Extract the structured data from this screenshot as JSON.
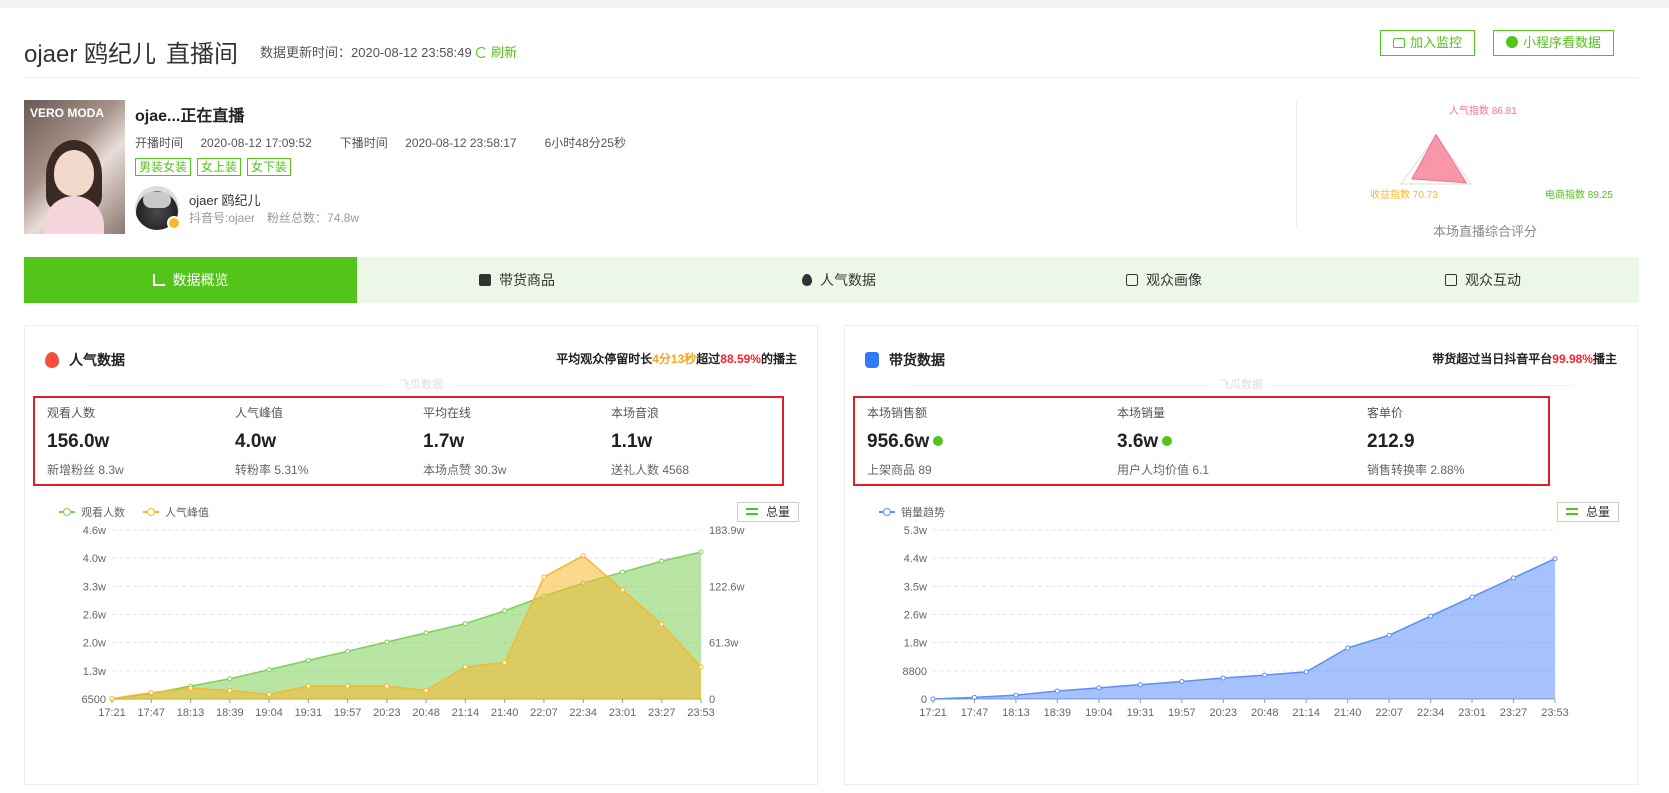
{
  "header": {
    "title_name": "ojaer 鸥纪儿",
    "title_suffix": "直播间",
    "update_label": "数据更新时间：",
    "update_time": "2020-08-12 23:58:49",
    "refresh_label": "刷新",
    "monitor_label": "加入监控",
    "miniapp_label": "小程序看数据"
  },
  "live": {
    "cover_logo": "VERO MODA",
    "title": "ojae...正在直播",
    "start_label": "开播时间",
    "start_time": "2020-08-12 17:09:52",
    "end_label": "下播时间",
    "end_time": "2020-08-12 23:58:17",
    "duration": "6小时48分25秒",
    "tags": [
      "男装女装",
      "女上装",
      "女下装"
    ],
    "author_name": "ojaer 鸥纪儿",
    "douyin_id": "抖音号:ojaer",
    "fans": "粉丝总数：74.8w"
  },
  "score": {
    "popularity": "人气指数 86.81",
    "revenue": "收益指数 70.73",
    "ecommerce": "电商指数 89.25",
    "title": "本场直播综合评分",
    "values": {
      "popularity": 86.81,
      "revenue": 70.73,
      "ecommerce": 89.25
    },
    "colors": {
      "popularity": "#f5738e",
      "revenue": "#f5b82e",
      "ecommerce": "#52c41a"
    }
  },
  "tabs": [
    {
      "label": "数据概览",
      "icon": "bar-chart-icon",
      "active": true
    },
    {
      "label": "带货商品",
      "icon": "shopping-bag-icon",
      "active": false
    },
    {
      "label": "人气数据",
      "icon": "fire-icon",
      "active": false
    },
    {
      "label": "观众画像",
      "icon": "audience-icon",
      "active": false
    },
    {
      "label": "观众互动",
      "icon": "interaction-icon",
      "active": false
    }
  ],
  "popularity": {
    "title": "人气数据",
    "note_prefix": "平均观众停留时长",
    "note_duration": "4分13秒",
    "note_mid": "超过",
    "note_percent": "88.59%",
    "note_suffix": "的播主",
    "watermark": "飞瓜数据",
    "stats": [
      {
        "label": "观看人数",
        "value": "156.0w",
        "sub": "新增粉丝 8.3w"
      },
      {
        "label": "人气峰值",
        "value": "4.0w",
        "sub": "转粉率 5.31%"
      },
      {
        "label": "平均在线",
        "value": "1.7w",
        "sub": "本场点赞 30.3w"
      },
      {
        "label": "本场音浪",
        "value": "1.1w",
        "sub": "送礼人数 4568"
      }
    ],
    "legend": [
      "观看人数",
      "人气峰值"
    ],
    "total_label": "总量"
  },
  "sales": {
    "title": "带货数据",
    "note_prefix": "带货超过当日抖音平台",
    "note_percent": "99.98%",
    "note_suffix": "播主",
    "watermark": "飞瓜数据",
    "stats": [
      {
        "label": "本场销售额",
        "value": "956.6w",
        "sub": "上架商品 89"
      },
      {
        "label": "本场销量",
        "value": "3.6w",
        "sub": "用户人均价值 6.1"
      },
      {
        "label": "客单价",
        "value": "212.9",
        "sub": "销售转换率 2.88%"
      }
    ],
    "legend": [
      "销量趋势"
    ],
    "total_label": "总量"
  },
  "chart_data": [
    {
      "type": "area",
      "x": [
        "17:21",
        "17:47",
        "18:13",
        "18:39",
        "19:04",
        "19:31",
        "19:57",
        "20:23",
        "20:48",
        "21:14",
        "21:40",
        "22:07",
        "22:34",
        "23:01",
        "23:27",
        "23:53"
      ],
      "y_left_ticks": [
        "6500",
        "1.3w",
        "2.0w",
        "2.6w",
        "3.3w",
        "4.0w",
        "4.6w"
      ],
      "y_right_ticks": [
        "0",
        "61.3w",
        "122.6w",
        "183.9w"
      ],
      "series": [
        {
          "name": "观看人数",
          "color": "#7ed05a",
          "axis": "right",
          "values": [
            0,
            6,
            14,
            22,
            32,
            42,
            52,
            62,
            72,
            82,
            96,
            112,
            126,
            138,
            150,
            160
          ]
        },
        {
          "name": "人气峰值",
          "color": "#f5b82e",
          "axis": "left",
          "values": [
            0.66,
            0.8,
            0.9,
            0.85,
            0.76,
            0.95,
            0.95,
            0.95,
            0.85,
            1.4,
            1.5,
            3.5,
            4.0,
            3.2,
            2.4,
            1.4
          ]
        }
      ]
    },
    {
      "type": "area",
      "x": [
        "17:21",
        "17:47",
        "18:13",
        "18:39",
        "19:04",
        "19:31",
        "19:57",
        "20:23",
        "20:48",
        "21:14",
        "21:40",
        "22:07",
        "22:34",
        "23:01",
        "23:27",
        "23:53"
      ],
      "y_ticks": [
        "0",
        "8800",
        "1.8w",
        "2.6w",
        "3.5w",
        "4.4w",
        "5.3w"
      ],
      "series": [
        {
          "name": "销量趋势",
          "color": "#5b8ff9",
          "values": [
            0,
            0.05,
            0.12,
            0.25,
            0.35,
            0.45,
            0.55,
            0.66,
            0.75,
            0.85,
            1.6,
            2.0,
            2.6,
            3.2,
            3.8,
            4.4
          ]
        }
      ]
    }
  ]
}
